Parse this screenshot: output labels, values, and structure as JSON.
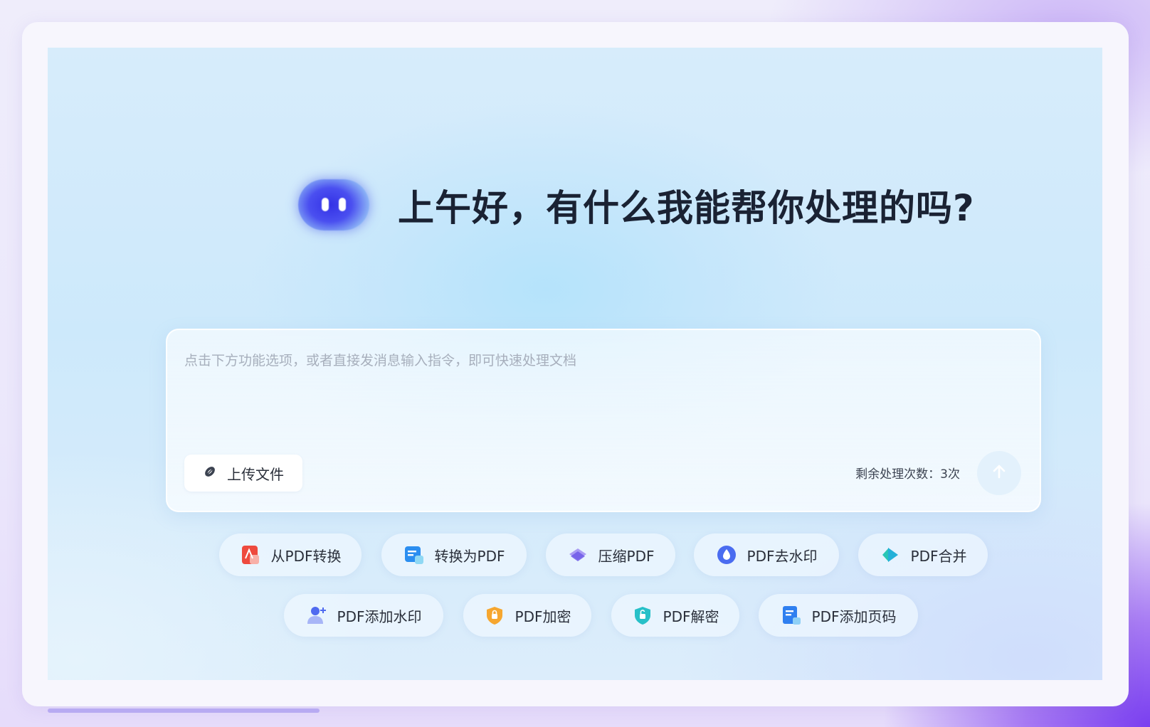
{
  "greeting": {
    "text": "上午好，有什么我能帮你处理的吗?"
  },
  "input": {
    "placeholder": "点击下方功能选项，或者直接发消息输入指令，即可快速处理文档"
  },
  "upload": {
    "label": "上传文件",
    "icon": "paperclip-icon"
  },
  "quota": {
    "text": "剩余处理次数：3次"
  },
  "send": {
    "icon": "arrow-up-icon"
  },
  "features": {
    "row1": [
      {
        "label": "从PDF转换",
        "icon": "pdf-convert-from-icon"
      },
      {
        "label": "转换为PDF",
        "icon": "convert-to-pdf-icon"
      },
      {
        "label": "压缩PDF",
        "icon": "compress-icon"
      },
      {
        "label": "PDF去水印",
        "icon": "remove-watermark-icon"
      },
      {
        "label": "PDF合并",
        "icon": "merge-icon"
      }
    ],
    "row2": [
      {
        "label": "PDF添加水印",
        "icon": "add-watermark-icon"
      },
      {
        "label": "PDF加密",
        "icon": "encrypt-icon"
      },
      {
        "label": "PDF解密",
        "icon": "decrypt-icon"
      },
      {
        "label": "PDF添加页码",
        "icon": "add-page-number-icon"
      }
    ]
  },
  "colors": {
    "accent": "#3a36e6",
    "text_primary": "#1a2233",
    "placeholder": "#a7afbc"
  }
}
